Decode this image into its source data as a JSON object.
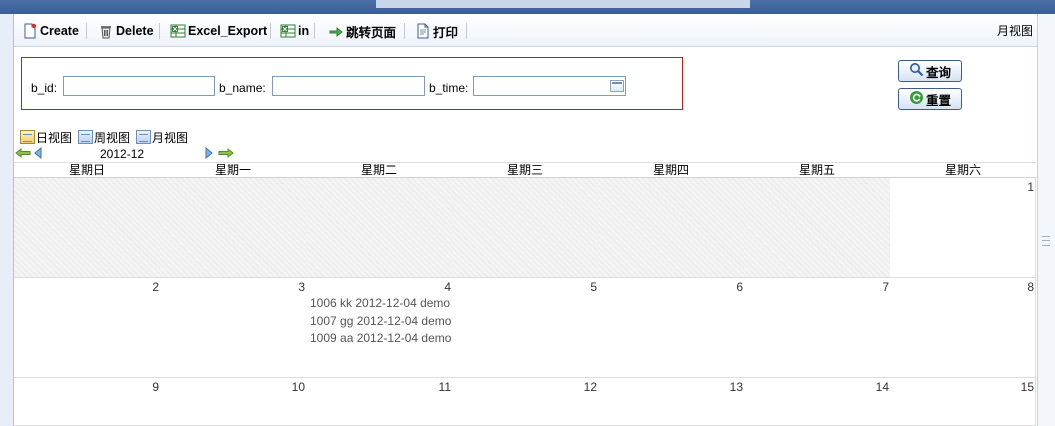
{
  "toolbar": {
    "create": "Create",
    "delete": "Delete",
    "excel_export": "Excel_Export",
    "in": "in",
    "jump_page": "跳转页面",
    "print": "打印",
    "current_view": "月视图"
  },
  "search": {
    "b_id_label": "b_id:",
    "b_id_value": "",
    "b_name_label": "b_name:",
    "b_name_value": "",
    "b_time_label": "b_time:",
    "b_time_value": "",
    "query_button": "查询",
    "reset_button": "重置"
  },
  "views": {
    "day": "日视图",
    "week": "周视图",
    "month": "月视图"
  },
  "calendar": {
    "month_label": "2012-12",
    "weekdays": [
      "星期日",
      "星期一",
      "星期二",
      "星期三",
      "星期四",
      "星期五",
      "星期六"
    ],
    "weeks": [
      [
        "",
        "",
        "",
        "",
        "",
        "",
        "1"
      ],
      [
        "2",
        "3",
        "4",
        "5",
        "6",
        "7",
        "8"
      ],
      [
        "9",
        "10",
        "11",
        "12",
        "13",
        "14",
        "15"
      ]
    ],
    "events": [
      "1006 kk 2012-12-04 demo",
      "1007 gg 2012-12-04 demo",
      "1009 aa 2012-12-04 demo"
    ]
  },
  "colors": {
    "accent": "#3a5e96",
    "search_border": "#b22222",
    "event_text": "#555555"
  }
}
